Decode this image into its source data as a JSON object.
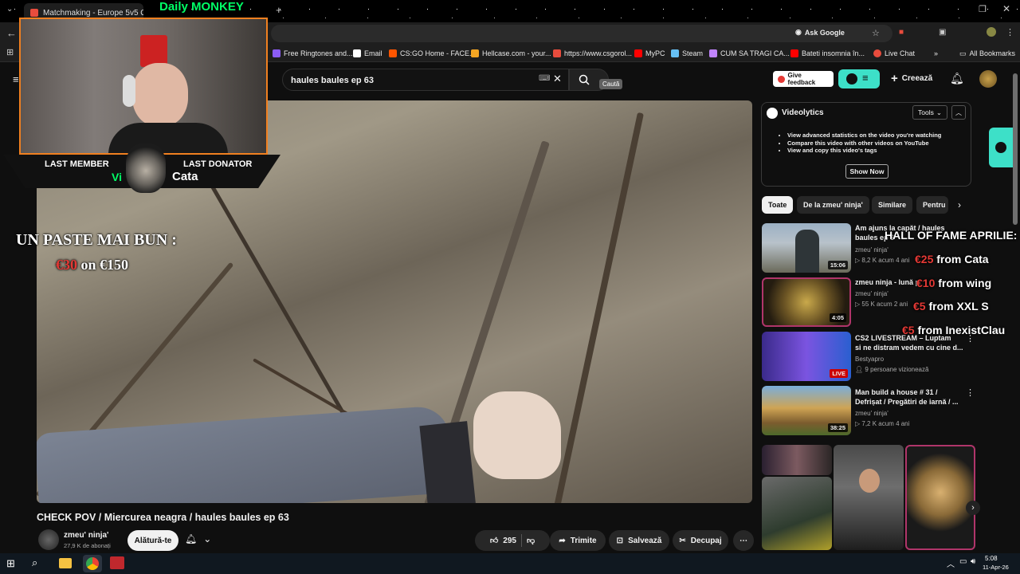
{
  "browser": {
    "tabs": [
      {
        "label": "Matchmaking - Europe 5v5 Q...",
        "color": "#e84c3d"
      },
      {
        "label": "Daily MONKEY",
        "color": "#00ff66"
      }
    ],
    "address_right": {
      "ask_google": "Ask Google"
    },
    "bookmarks": [
      {
        "label": "Free Ringtones and...",
        "color": "#8b5cf6"
      },
      {
        "label": "Email",
        "color": "#ffffff"
      },
      {
        "label": "CS:GO Home - FACE...",
        "color": "#ff5500"
      },
      {
        "label": "Hellcase.com - your...",
        "color": "#f5a623"
      },
      {
        "label": "https://www.csgorol...",
        "color": "#e84c3d"
      },
      {
        "label": "MyPC",
        "color": "#ff0000"
      },
      {
        "label": "Steam",
        "color": "#66c0f4"
      },
      {
        "label": "CUM SA TRAGI CA...",
        "color": "#c084fc"
      },
      {
        "label": "Bateti insomnia în...",
        "color": "#ff0000"
      },
      {
        "label": "Live Chat",
        "color": "#e84c3d"
      },
      {
        "label": "All Bookmarks",
        "color": "#aaaaaa"
      }
    ]
  },
  "youtube": {
    "search": {
      "value": "haules baules ep 63",
      "tooltip": "Caută"
    },
    "header": {
      "feedback": "Give feedback",
      "create": "Creează"
    },
    "video": {
      "title": "CHECK POV / Miercurea neagra / haules baules ep 63",
      "channel": "zmeu' ninja'",
      "subscribers": "27,9 K de abonați",
      "join": "Alătură-te",
      "likes": "295",
      "share": "Trimite",
      "save": "Salvează",
      "clip": "Decupaj"
    },
    "videolytics": {
      "name": "Videolytics",
      "tools": "Tools",
      "bullets": [
        "View advanced statistics on the video you're watching",
        "Compare this video with other videos on YouTube",
        "View and copy this video's tags"
      ],
      "show_now": "Show Now"
    },
    "chips": [
      "Toate",
      "De la zmeu' ninja'",
      "Similare",
      "Pentru"
    ],
    "recommendations": [
      {
        "title_l1": "Am ajuns la capăt / haules",
        "title_l2": "baules ep 6",
        "channel": "zmeu' ninja'",
        "meta": "8,2 K  acum 4 ani",
        "duration": "15:06"
      },
      {
        "title_l1": "zmeu ninja - lună p",
        "title_l2": "",
        "channel": "zmeu' ninja'",
        "meta": "55 K  acum 2 ani",
        "duration": "4:05"
      },
      {
        "title_l1": "CS2 LIVESTREAM – Luptam",
        "title_l2": "si ne distram vedem cu cine d...",
        "channel": "Bestyapro",
        "meta": "9 persoane vizionează",
        "duration": "LIVE"
      },
      {
        "title_l1": "Man build a house # 31 /",
        "title_l2": "Defrișat / Pregătiri de iarnă / ...",
        "channel": "zmeu' ninja'",
        "meta": "7,2 K  acum 4 ani",
        "duration": "38:25"
      }
    ]
  },
  "overlay": {
    "last_member": "LAST MEMBER",
    "last_member_name": "Vi",
    "last_donator": "LAST DONATOR",
    "last_donator_name": "Cata",
    "paste_title": "UN PASTE MAI BUN :",
    "paste_amount": "€30",
    "paste_on": "on €150",
    "hall_of_fame": "HALL OF FAME APRILIE:",
    "donations": [
      {
        "amount": "€25",
        "name": "from Cata"
      },
      {
        "amount": "€10",
        "name": "from wing"
      },
      {
        "amount": "€5",
        "name": "from XXL S"
      },
      {
        "amount": "€5",
        "name": "from InexistClau"
      }
    ]
  },
  "taskbar": {
    "time": "5:08",
    "date": "11-Apr-26"
  }
}
